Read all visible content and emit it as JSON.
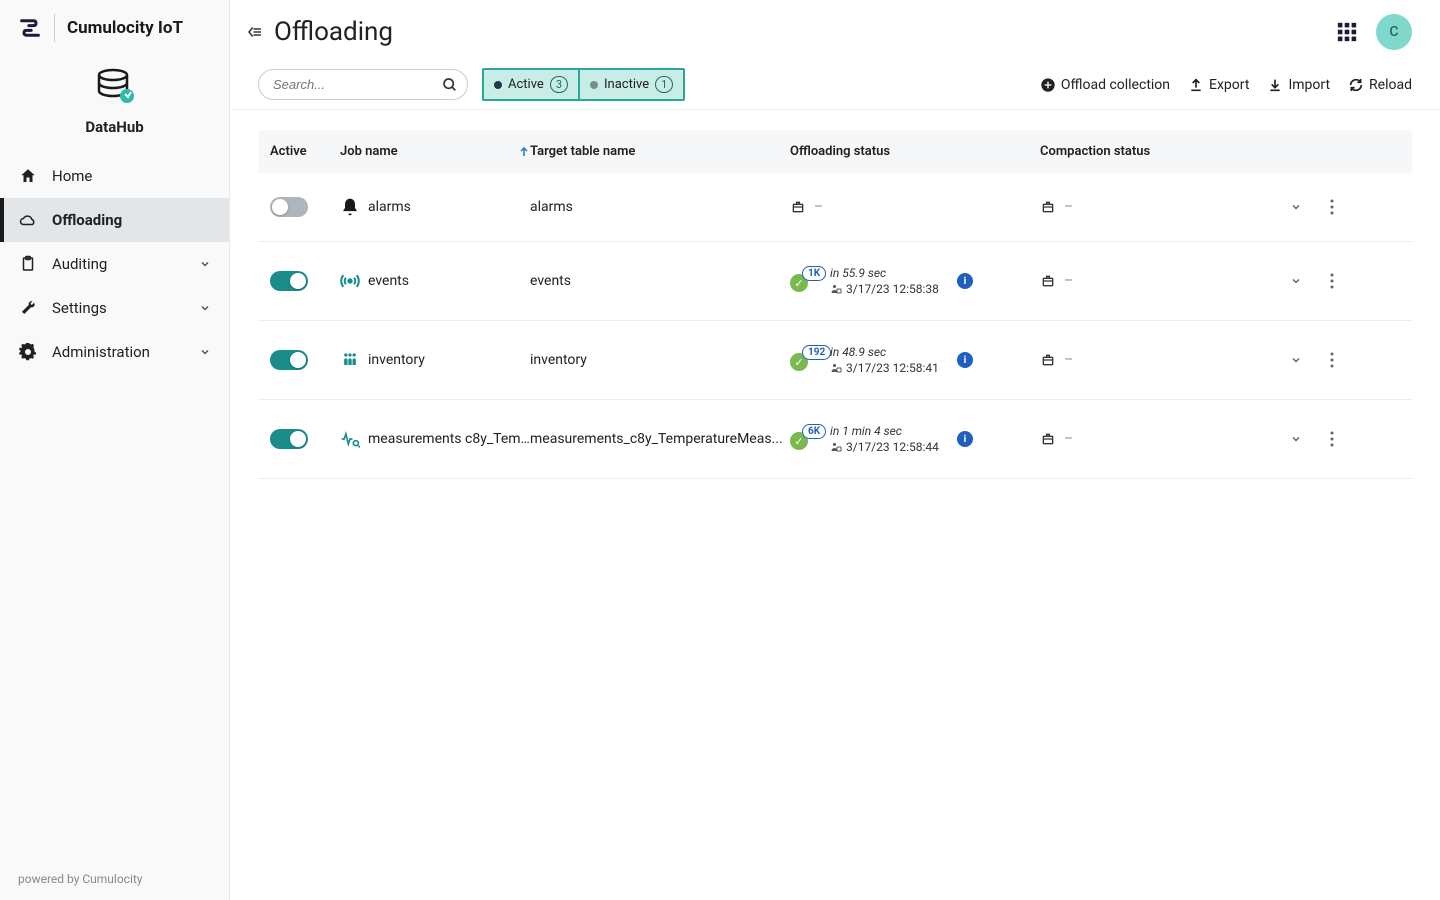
{
  "brand": {
    "name": "Cumulocity IoT",
    "product": "DataHub"
  },
  "nav": {
    "home": "Home",
    "offloading": "Offloading",
    "auditing": "Auditing",
    "settings": "Settings",
    "administration": "Administration"
  },
  "header": {
    "title": "Offloading",
    "avatar_initial": "C"
  },
  "toolbar": {
    "search_placeholder": "Search...",
    "active_label": "Active",
    "active_count": "3",
    "inactive_label": "Inactive",
    "inactive_count": "1",
    "offload_collection": "Offload collection",
    "export": "Export",
    "import": "Import",
    "reload": "Reload"
  },
  "columns": {
    "active": "Active",
    "job": "Job name",
    "target": "Target table name",
    "offstatus": "Offloading status",
    "compstatus": "Compaction status"
  },
  "rows": [
    {
      "active": false,
      "job_icon": "bell-icon",
      "job_name": "alarms",
      "target": "alarms",
      "offloading": {
        "dash": true
      },
      "compaction": {
        "dash": true
      }
    },
    {
      "active": true,
      "job_icon": "broadcast-icon",
      "job_name": "events",
      "target": "events",
      "offloading": {
        "count": "1K",
        "duration": "in 55.9 sec",
        "ts": "3/17/23 12:58:38",
        "info": true
      },
      "compaction": {
        "dash": true
      }
    },
    {
      "active": true,
      "job_icon": "people-icon",
      "job_name": "inventory",
      "target": "inventory",
      "offloading": {
        "count": "192",
        "duration": "in 48.9 sec",
        "ts": "3/17/23 12:58:41",
        "info": true
      },
      "compaction": {
        "dash": true
      }
    },
    {
      "active": true,
      "job_icon": "pulse-search-icon",
      "job_name": "measurements c8y_Temp...",
      "target": "measurements_c8y_TemperatureMeas...",
      "offloading": {
        "count": "6K",
        "duration": "in 1 min 4 sec",
        "ts": "3/17/23 12:58:44",
        "info": true
      },
      "compaction": {
        "dash": true
      }
    }
  ],
  "footer": "powered by Cumulocity"
}
